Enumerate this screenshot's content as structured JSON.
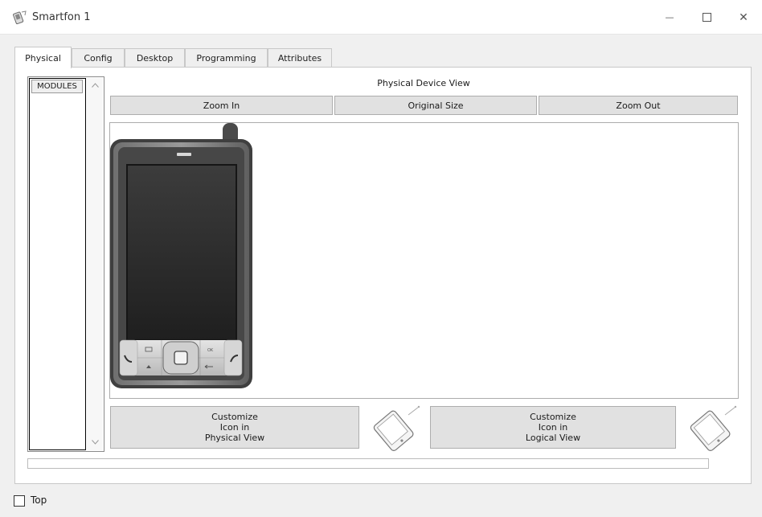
{
  "window": {
    "title": "Smartfon 1",
    "minimize_glyph": "—",
    "close_glyph": "✕"
  },
  "tabs": [
    {
      "label": "Physical",
      "active": true
    },
    {
      "label": "Config",
      "active": false
    },
    {
      "label": "Desktop",
      "active": false
    },
    {
      "label": "Programming",
      "active": false
    },
    {
      "label": "Attributes",
      "active": false
    }
  ],
  "modules": {
    "items": [
      "MODULES"
    ]
  },
  "device_view": {
    "title": "Physical Device View",
    "zoom_in": "Zoom In",
    "original_size": "Original Size",
    "zoom_out": "Zoom Out"
  },
  "customize": {
    "physical": [
      "Customize",
      "Icon in",
      "Physical View"
    ],
    "logical": [
      "Customize",
      "Icon in",
      "Logical View"
    ]
  },
  "footer": {
    "top_label": "Top",
    "top_checked": false
  },
  "icons": {
    "app": "pda-icon",
    "device": "smartphone-device",
    "customize": "tablet-edit-icon"
  }
}
